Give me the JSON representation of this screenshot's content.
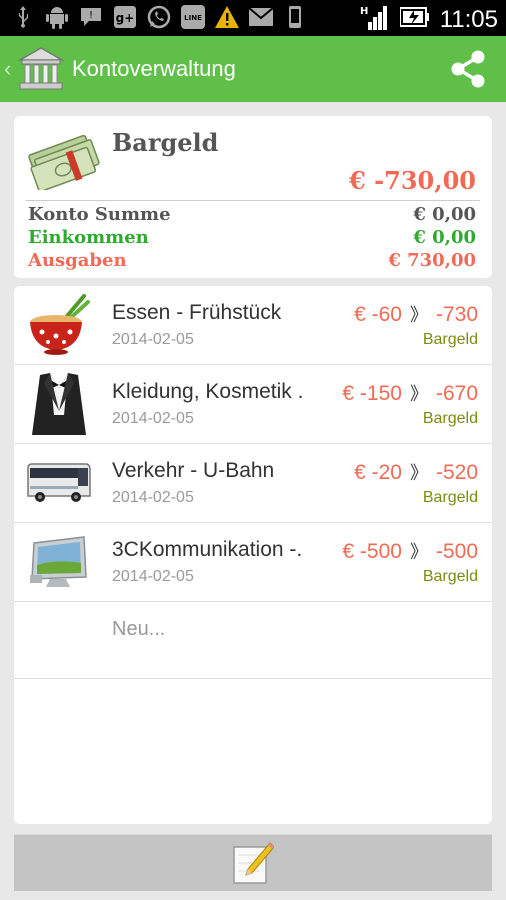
{
  "status_bar": {
    "icons": [
      "usb-icon",
      "android-icon",
      "chat-icon",
      "google-plus-icon",
      "whatsapp-icon",
      "line-icon",
      "warning-icon",
      "mail-icon",
      "phone-icon"
    ],
    "network": "H",
    "time": "11:05"
  },
  "action_bar": {
    "title": "Kontoverwaltung",
    "back_glyph": "‹"
  },
  "account": {
    "name": "Bargeld",
    "total": "€ -730,00",
    "summary": [
      {
        "label": "Konto Summe",
        "value": "€ 0,00"
      },
      {
        "label": "Einkommen",
        "value": "€ 0,00"
      },
      {
        "label": "Ausgaben",
        "value": "€ 730,00"
      }
    ]
  },
  "transactions": [
    {
      "icon": "noodle-bowl-icon",
      "title": "Essen - Frühstück",
      "amount": "€ -60",
      "separator": "》",
      "balance": "-730",
      "date": "2014-02-05",
      "account": "Bargeld"
    },
    {
      "icon": "tuxedo-icon",
      "title": "Kleidung, Kosmetik .",
      "amount": "€ -150",
      "separator": "》",
      "balance": "-670",
      "date": "2014-02-05",
      "account": "Bargeld"
    },
    {
      "icon": "bus-icon",
      "title": "Verkehr - U-Bahn",
      "amount": "€ -20",
      "separator": "》",
      "balance": "-520",
      "date": "2014-02-05",
      "account": "Bargeld"
    },
    {
      "icon": "monitor-icon",
      "title": "3CKommunikation -.",
      "amount": "€ -500",
      "separator": "》",
      "balance": "-500",
      "date": "2014-02-05",
      "account": "Bargeld"
    }
  ],
  "new_item_placeholder": "Neu...",
  "colors": {
    "accent": "#5fbf48",
    "expense": "#f26a55",
    "income": "#2eaa2e",
    "account_label": "#7b8c12"
  }
}
